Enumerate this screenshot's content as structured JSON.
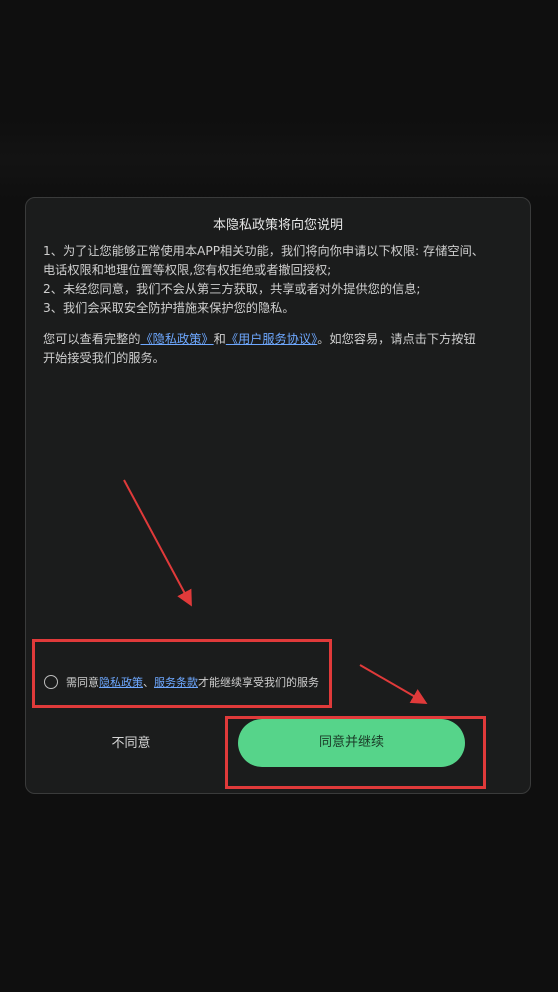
{
  "dialog": {
    "title": "本隐私政策将向您说明",
    "lines": [
      "1、为了让您能够正常使用本APP相关功能，我们将向你申请以下权限: 存储空间、",
      "电话权限和地理位置等权限,您有权拒绝或者撤回授权;",
      "2、未经您同意，我们不会从第三方获取，共享或者对外提供您的信息;",
      "3、我们会采取安全防护措施来保护您的隐私。"
    ],
    "para2": {
      "prefix": "您可以查看完整的",
      "link1": "《隐私政策》",
      "and": "和",
      "link2": "《用户服务协议》",
      "suffix": "。如您容易，请点击下方按钮",
      "line2": "开始接受我们的服务。"
    },
    "agree_row": {
      "prefix": "需同意",
      "link1": "隐私政策",
      "sep": "、",
      "link2": "服务条款",
      "suffix": "才能继续享受我们的服务"
    },
    "disagree_label": "不同意",
    "agree_label": "同意并继续"
  },
  "colors": {
    "background": "#0f0f0f",
    "dialog": "#1b1c1c",
    "accent_green": "#56d48a",
    "link": "#6ea8ff",
    "annotation_red": "#e03a3a"
  }
}
